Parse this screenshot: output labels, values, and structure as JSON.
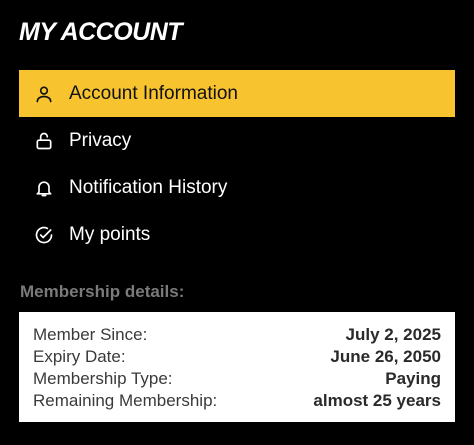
{
  "header": {
    "title": "MY ACCOUNT"
  },
  "menu": {
    "items": [
      {
        "label": "Account Information",
        "icon": "user-icon",
        "active": true
      },
      {
        "label": "Privacy",
        "icon": "lock-icon",
        "active": false
      },
      {
        "label": "Notification History",
        "icon": "bell-icon",
        "active": false
      },
      {
        "label": "My points",
        "icon": "check-circle-icon",
        "active": false
      }
    ]
  },
  "membership": {
    "section_label": "Membership details:",
    "rows": [
      {
        "key": "Member Since:",
        "value": "July 2, 2025"
      },
      {
        "key": "Expiry Date:",
        "value": "June 26, 2050"
      },
      {
        "key": "Membership Type:",
        "value": "Paying"
      },
      {
        "key": "Remaining Membership:",
        "value": "almost 25 years"
      }
    ]
  },
  "colors": {
    "background": "#000000",
    "accent": "#f7c42f",
    "section_label": "#7a7a7a",
    "card": "#ffffff"
  }
}
